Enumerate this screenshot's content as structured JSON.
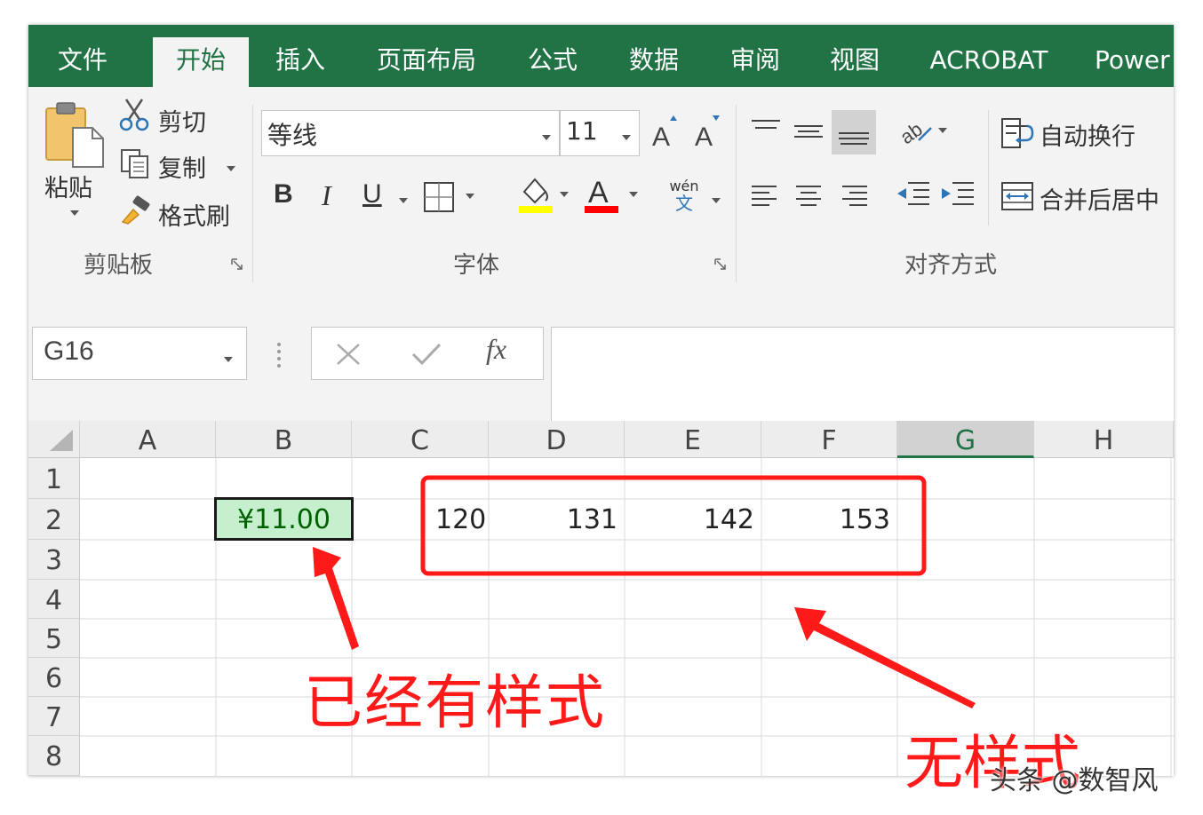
{
  "tabs": [
    "文件",
    "开始",
    "插入",
    "页面布局",
    "公式",
    "数据",
    "审阅",
    "视图",
    "ACROBAT",
    "Power"
  ],
  "clipboard": {
    "paste": "粘贴",
    "cut": "剪切",
    "copy": "复制",
    "format_painter": "格式刷",
    "group_label": "剪贴板"
  },
  "font": {
    "name": "等线",
    "size": "11",
    "bold": "B",
    "italic": "I",
    "underline": "U",
    "phonetic_top": "wén",
    "phonetic_bottom": "文",
    "font_color_glyph": "A",
    "group_label": "字体"
  },
  "alignment": {
    "wrap_text": "自动换行",
    "merge_center": "合并后居中",
    "group_label": "对齐方式"
  },
  "formula_bar": {
    "name_box": "G16",
    "fx": "fx",
    "value": ""
  },
  "sheet": {
    "columns": [
      "A",
      "B",
      "C",
      "D",
      "E",
      "F",
      "G",
      "H"
    ],
    "rows": [
      "1",
      "2",
      "3",
      "4",
      "5",
      "6",
      "7",
      "8"
    ],
    "cells": {
      "B2": "¥11.00",
      "C2": "120",
      "D2": "131",
      "E2": "142",
      "F2": "153"
    }
  },
  "annotations": {
    "styled": "已经有样式",
    "unstyled": "无样式"
  },
  "watermark": "头条 @数智风",
  "colors": {
    "ribbon_green": "#217346",
    "annotation_red": "#ff1a1a",
    "styled_cell_fill": "#c6efce",
    "styled_cell_text": "#006100"
  }
}
